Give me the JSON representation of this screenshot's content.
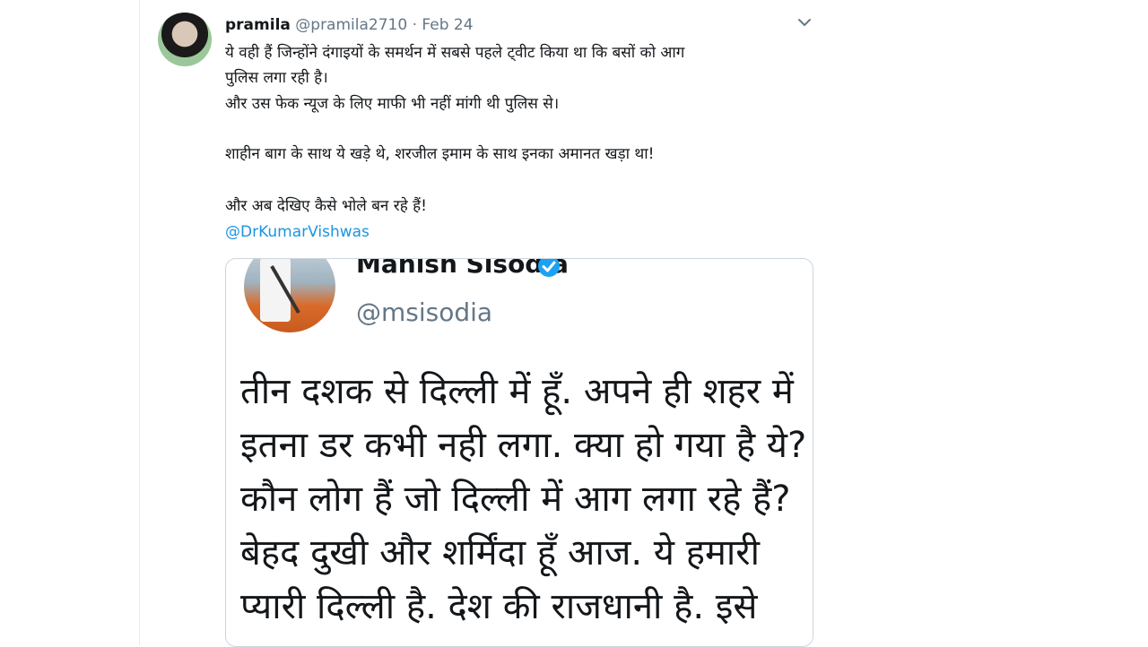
{
  "tweet": {
    "display_name": "pramila",
    "handle": "@pramila2710",
    "separator": "·",
    "date": "Feb 24",
    "lines": [
      "ये वही हैं जिन्होंने दंगाइयों के समर्थन में सबसे पहले ट्वीट किया था कि बसों को आग",
      "पुलिस लगा रही है।",
      "और उस फेक न्यूज के लिए माफी भी नहीं मांगी थी पुलिस से।",
      "शाहीन बाग के साथ ये खड़े थे, शरजील इमाम के साथ इनका अमानत खड़ा था!",
      "और अब देखिए कैसे भोले बन रहे हैं!"
    ],
    "mention": "@DrKumarVishwas",
    "menu_icon": "chevron-down-icon"
  },
  "quoted": {
    "name": "Manish Sisodia",
    "handle": "@msisodia",
    "verified_icon": "verified-badge-icon",
    "lines": [
      "तीन दशक से दिल्ली में हूँ. अपने ही शहर में",
      "इतना डर कभी नही लगा. क्या हो गया है ये?",
      "कौन लोग हैं जो दिल्ली में आग लगा रहे हैं?",
      "बेहद दुखी और शर्मिंदा हूँ आज. ये हमारी",
      "प्यारी दिल्ली है. देश की राजधानी है. इसे"
    ]
  },
  "colors": {
    "link": "#1b95e0",
    "text": "#14171a",
    "muted": "#657786",
    "border": "#ccd6dd"
  }
}
